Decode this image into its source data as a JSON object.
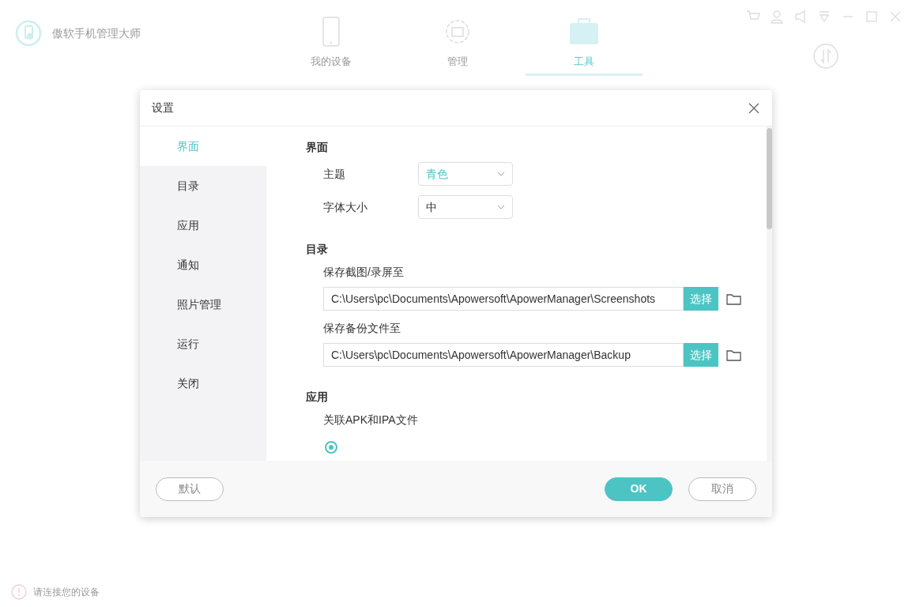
{
  "app": {
    "title": "傲软手机管理大师"
  },
  "nav_tabs": [
    {
      "label": "我的设备",
      "selected": false
    },
    {
      "label": "管理",
      "selected": false
    },
    {
      "label": "工具",
      "selected": true
    }
  ],
  "status_bar": {
    "text": "请连接您的设备"
  },
  "dialog": {
    "title": "设置",
    "sidebar": [
      {
        "label": "界面",
        "selected": true
      },
      {
        "label": "目录",
        "selected": false
      },
      {
        "label": "应用",
        "selected": false
      },
      {
        "label": "通知",
        "selected": false
      },
      {
        "label": "照片管理",
        "selected": false
      },
      {
        "label": "运行",
        "selected": false
      },
      {
        "label": "关闭",
        "selected": false
      }
    ],
    "sections": [
      {
        "heading": "界面",
        "rows": [
          {
            "kind": "select",
            "label": "主题",
            "value": "青色",
            "accent": true
          },
          {
            "kind": "select",
            "label": "字体大小",
            "value": "中",
            "accent": false
          }
        ]
      },
      {
        "heading": "目录",
        "rows": [
          {
            "kind": "path",
            "label": "保存截图/录屏至",
            "value": "C:\\Users\\pc\\Documents\\Apowersoft\\ApowerManager\\Screenshots",
            "button": "选择"
          },
          {
            "kind": "path",
            "label": "保存备份文件至",
            "value": "C:\\Users\\pc\\Documents\\Apowersoft\\ApowerManager\\Backup",
            "button": "选择"
          }
        ]
      },
      {
        "heading": "应用",
        "rows": [
          {
            "kind": "caption",
            "label": "关联APK和IPA文件",
            "checked": true
          }
        ]
      }
    ],
    "buttons": [
      {
        "label": "默认",
        "kind": "outline"
      },
      {
        "label": "OK",
        "kind": "primary"
      },
      {
        "label": "取消",
        "kind": "outline"
      }
    ]
  }
}
